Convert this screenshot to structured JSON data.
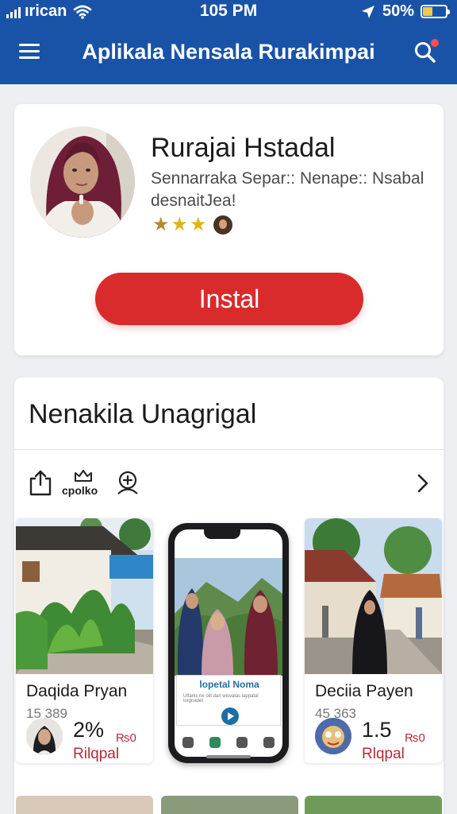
{
  "status_bar": {
    "carrier": "ırican",
    "time": "105 PM",
    "battery": "50%"
  },
  "app_bar": {
    "title": "Aplikala Nensala Rurakimpai"
  },
  "profile": {
    "name": "Rurajai Hstadal",
    "description": "Sennarraka Separ:: Nenape:: Nsabal desnaitJea!",
    "rating_icons": [
      "star-bronze",
      "star-gold",
      "star-gold",
      "badge"
    ],
    "install_label": "Instal"
  },
  "gallery": {
    "title": "Nenakila Unagrigal",
    "tools": [
      {
        "icon": "share-icon",
        "label": ""
      },
      {
        "icon": "crown-icon",
        "label": "cpolko"
      },
      {
        "icon": "add-person-icon",
        "label": ""
      }
    ],
    "items": [
      {
        "name": "Daqida Pryan",
        "count": "15 389",
        "stat": "2%",
        "price": "₨0",
        "sub": "Rilqpal"
      },
      {
        "overlay_title": "lopetal Noma",
        "overlay_sub": "Ulfanis ne olit dan wisvalas lappatal lorgnadet"
      },
      {
        "name": "Deciia Payen",
        "count": "45 363",
        "stat": "1.5",
        "price": "₨0",
        "sub": "Rlqpal"
      }
    ]
  },
  "colors": {
    "header": "#1953a8",
    "install": "#d92b2b",
    "accent_red": "#b82b3a",
    "background": "#eeeff2"
  }
}
